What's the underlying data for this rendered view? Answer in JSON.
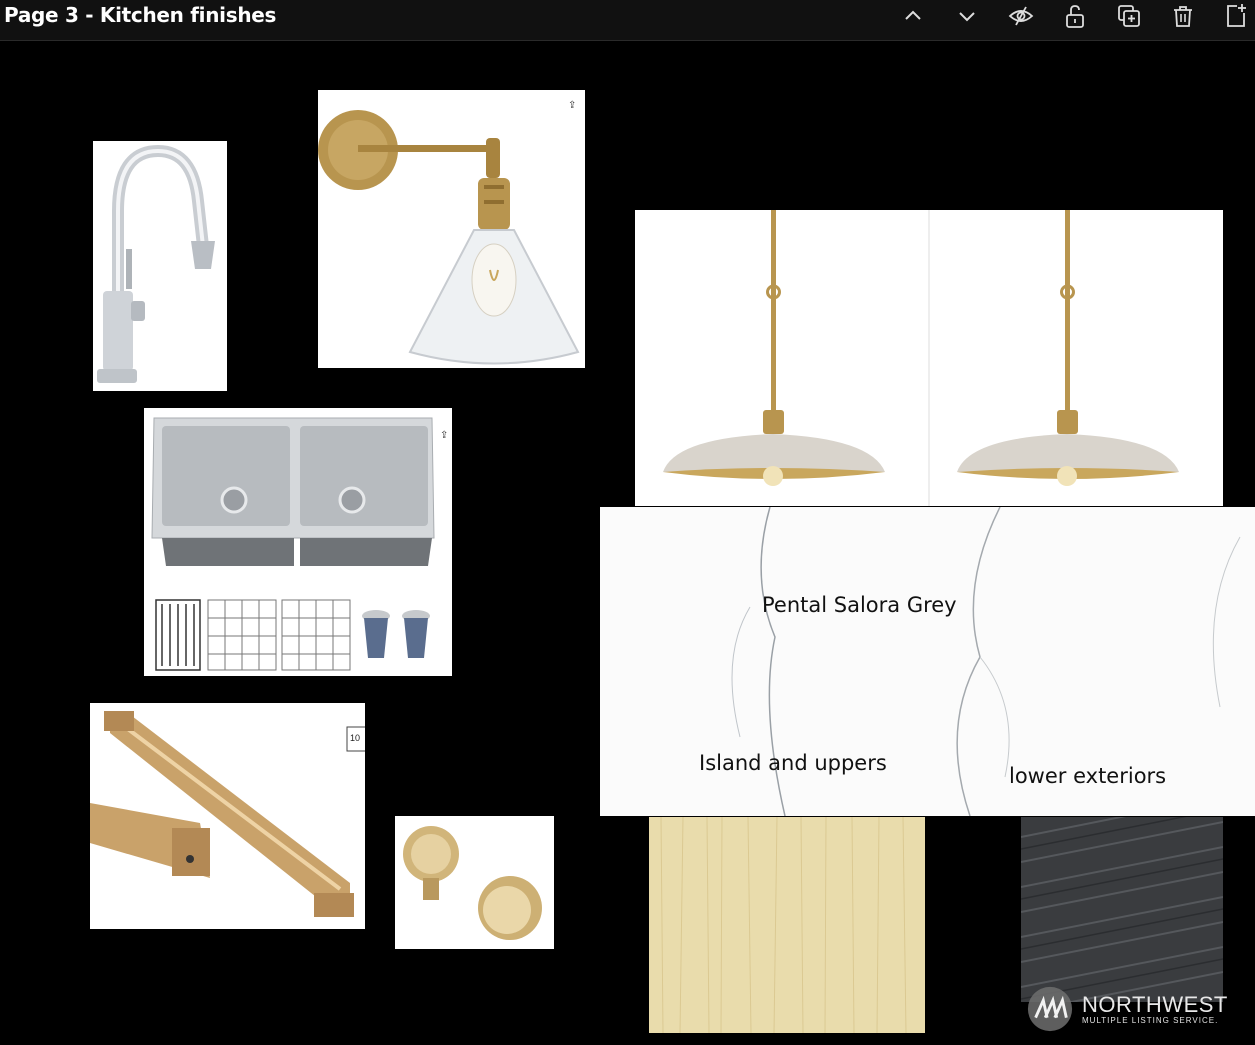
{
  "page": {
    "title": "Page 3 - Kitchen finishes"
  },
  "toolbar": {
    "icons": [
      "chevron-up-icon",
      "chevron-down-icon",
      "eye-off-icon",
      "lock-open-icon",
      "duplicate-icon",
      "trash-icon",
      "add-page-icon"
    ]
  },
  "board": {
    "countertop_label": "Pental Salora Grey",
    "island_label": "Island and uppers",
    "lower_label": "lower exteriors"
  },
  "watermark": {
    "name": "NORTHWEST",
    "sub": "MULTIPLE LISTING SERVICE."
  },
  "colors": {
    "brass": "#b8954f",
    "background": "#000000",
    "toolbar": "#111111"
  }
}
